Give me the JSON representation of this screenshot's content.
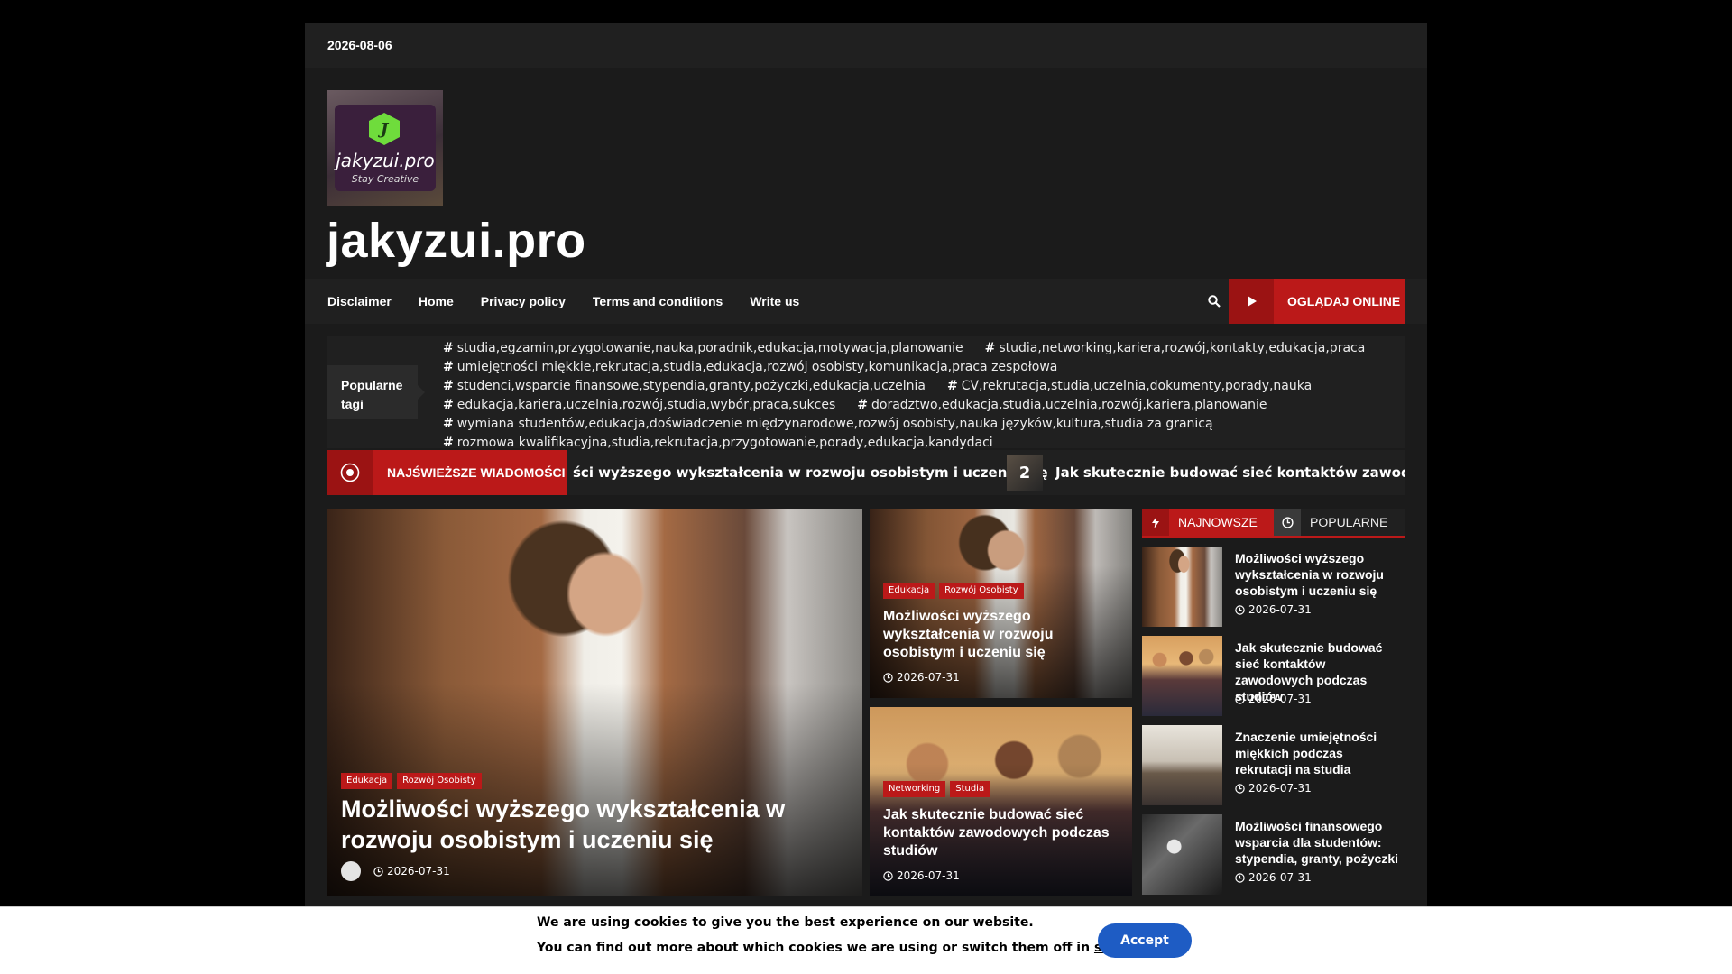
{
  "topbar": {
    "date": "2026-08-06"
  },
  "brand": {
    "logo_glyph": "J",
    "logo_title": "jakyzui.pro",
    "logo_tagline": "Stay Creative",
    "site_title": "jakyzui.pro"
  },
  "nav": {
    "items": [
      {
        "label": "Disclaimer"
      },
      {
        "label": "Home"
      },
      {
        "label": "Privacy policy"
      },
      {
        "label": "Terms and conditions"
      },
      {
        "label": "Write us"
      }
    ],
    "watch_label": "OGLĄDAJ ONLINE"
  },
  "tags": {
    "label": "Popularne tagi",
    "items": [
      "studia,egzamin,przygotowanie,nauka,poradnik,edukacja,motywacja,planowanie",
      "studia,networking,kariera,rozwój,kontakty,edukacja,praca",
      "umiejętności miękkie,rekrutacja,studia,edukacja,rozwój osobisty,komunikacja,praca zespołowa",
      "studenci,wsparcie finansowe,stypendia,granty,pożyczki,edukacja,uczelnia",
      "CV,rekrutacja,studia,uczelnia,dokumenty,porady,nauka",
      "edukacja,kariera,uczelnia,rozwój,studia,wybór,praca,sukces",
      "doradztwo,edukacja,studia,uczelnia,rozwój,kariera,planowanie",
      "wymiana studentów,edukacja,doświadczenie międzynarodowe,rozwój osobisty,nauka języków,kultura,studia za granicą",
      "rozmowa kwalifikacyjna,studia,rekrutacja,przygotowanie,porady,edukacja,kandydaci"
    ]
  },
  "ticker": {
    "label": "NAJŚWIEŻSZE WIADOMOŚCI",
    "item1": "ści wyższego wykształcenia w rozwoju osobistym i uczeniu się",
    "item2_num": "2",
    "item2": "Jak skutecznie budować sieć kontaktów zawodowych p"
  },
  "featured": {
    "cats": [
      "Edukacja",
      "Rozwój Osobisty"
    ],
    "title": "Możliwości wyższego wykształcenia w rozwoju osobistym i uczeniu się",
    "date": "2026-07-31"
  },
  "cards": [
    {
      "cats": [
        "Edukacja",
        "Rozwój Osobisty"
      ],
      "title": "Możliwości wyższego wykształcenia w rozwoju osobistym i uczeniu się",
      "date": "2026-07-31"
    },
    {
      "cats": [
        "Networking",
        "Studia"
      ],
      "title": "Jak skutecznie budować sieć kontaktów zawodowych podczas studiów",
      "date": "2026-07-31"
    }
  ],
  "sidebar": {
    "tab_latest": "NAJNOWSZE",
    "tab_popular": "POPULARNE",
    "posts": [
      {
        "title": "Możliwości wyższego wykształcenia w rozwoju osobistym i uczeniu się",
        "date": "2026-07-31"
      },
      {
        "title": "Jak skutecznie budować sieć kontaktów zawodowych podczas studiów",
        "date": "2026-07-31"
      },
      {
        "title": "Znaczenie umiejętności miękkich podczas rekrutacji na studia",
        "date": "2026-07-31"
      },
      {
        "title": "Możliwości finansowego wsparcia dla studentów: stypendia, granty, pożyczki",
        "date": "2026-07-31"
      }
    ]
  },
  "cookie": {
    "line1": "We are using cookies to give you the best experience on our website.",
    "line2_pre": "You can find out more about which cookies we are using or switch them off in ",
    "line2_link": "settings",
    "line2_post": ".",
    "accept": "Accept"
  },
  "colors": {
    "accent": "#bb1919",
    "accent_dark": "#9b1313",
    "cookie_button": "#1e5cc4"
  }
}
